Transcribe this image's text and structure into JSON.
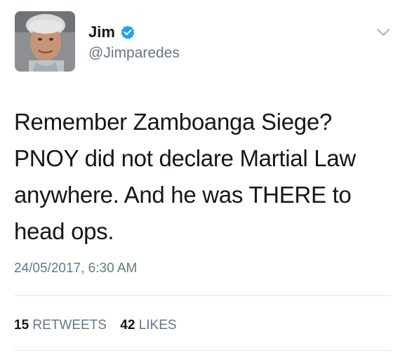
{
  "author": {
    "display_name": "Jim",
    "handle": "@Jimparedes",
    "verified": true,
    "verified_color": "#1da1f2"
  },
  "tweet": {
    "lines": [
      "Remember Zamboanga Siege?",
      "PNOY did not declare Martial Law",
      "anywhere. And he was THERE to",
      "head ops."
    ],
    "timestamp": "24/05/2017, 6:30 AM"
  },
  "stats": {
    "retweets_count": "15",
    "retweets_label": "RETWEETS",
    "likes_count": "42",
    "likes_label": "LIKES"
  },
  "icons": {
    "menu": "chevron-down-icon",
    "verified": "verified-badge-icon"
  },
  "colors": {
    "text": "#14171a",
    "secondary": "#657786",
    "divider": "#e1e8ed"
  }
}
